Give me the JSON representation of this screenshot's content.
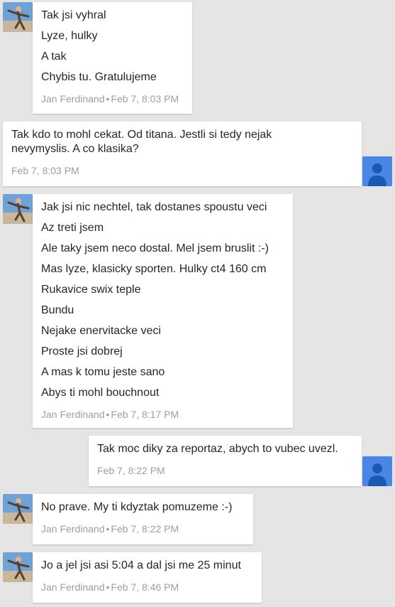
{
  "author": "Jan Ferdinand",
  "separator": "•",
  "messages": [
    {
      "lines": [
        "Tak jsi vyhral",
        "Lyze, hulky",
        "A tak",
        "Chybis tu. Gratulujeme"
      ],
      "time": "Feb 7, 8:03 PM"
    },
    {
      "lines": [
        "Tak kdo to mohl cekat. Od titana. Jestli si tedy nejak nevymyslis. A co klasika?"
      ],
      "time": "Feb 7, 8:03 PM"
    },
    {
      "lines": [
        "Jak jsi nic nechtel, tak dostanes spoustu veci",
        "Az treti jsem",
        "Ale taky jsem neco dostal. Mel jsem bruslit :-)",
        "Mas lyze, klasicky sporten. Hulky ct4 160 cm",
        "Rukavice swix teple",
        "Bundu",
        "Nejake enervitacke veci",
        "Proste jsi dobrej",
        "A mas k tomu jeste sano",
        "Abys ti mohl bouchnout"
      ],
      "time": "Feb 7, 8:17 PM"
    },
    {
      "lines": [
        "Tak moc diky za reportaz, abych to vubec uvezl."
      ],
      "time": "Feb 7, 8:22 PM"
    },
    {
      "lines": [
        "No prave. My ti kdyztak pomuzeme :-)"
      ],
      "time": "Feb 7, 8:22 PM"
    },
    {
      "lines": [
        "Jo a jel jsi asi 5:04 a dal jsi me 25 minut"
      ],
      "time": "Feb 7, 8:46 PM"
    }
  ]
}
